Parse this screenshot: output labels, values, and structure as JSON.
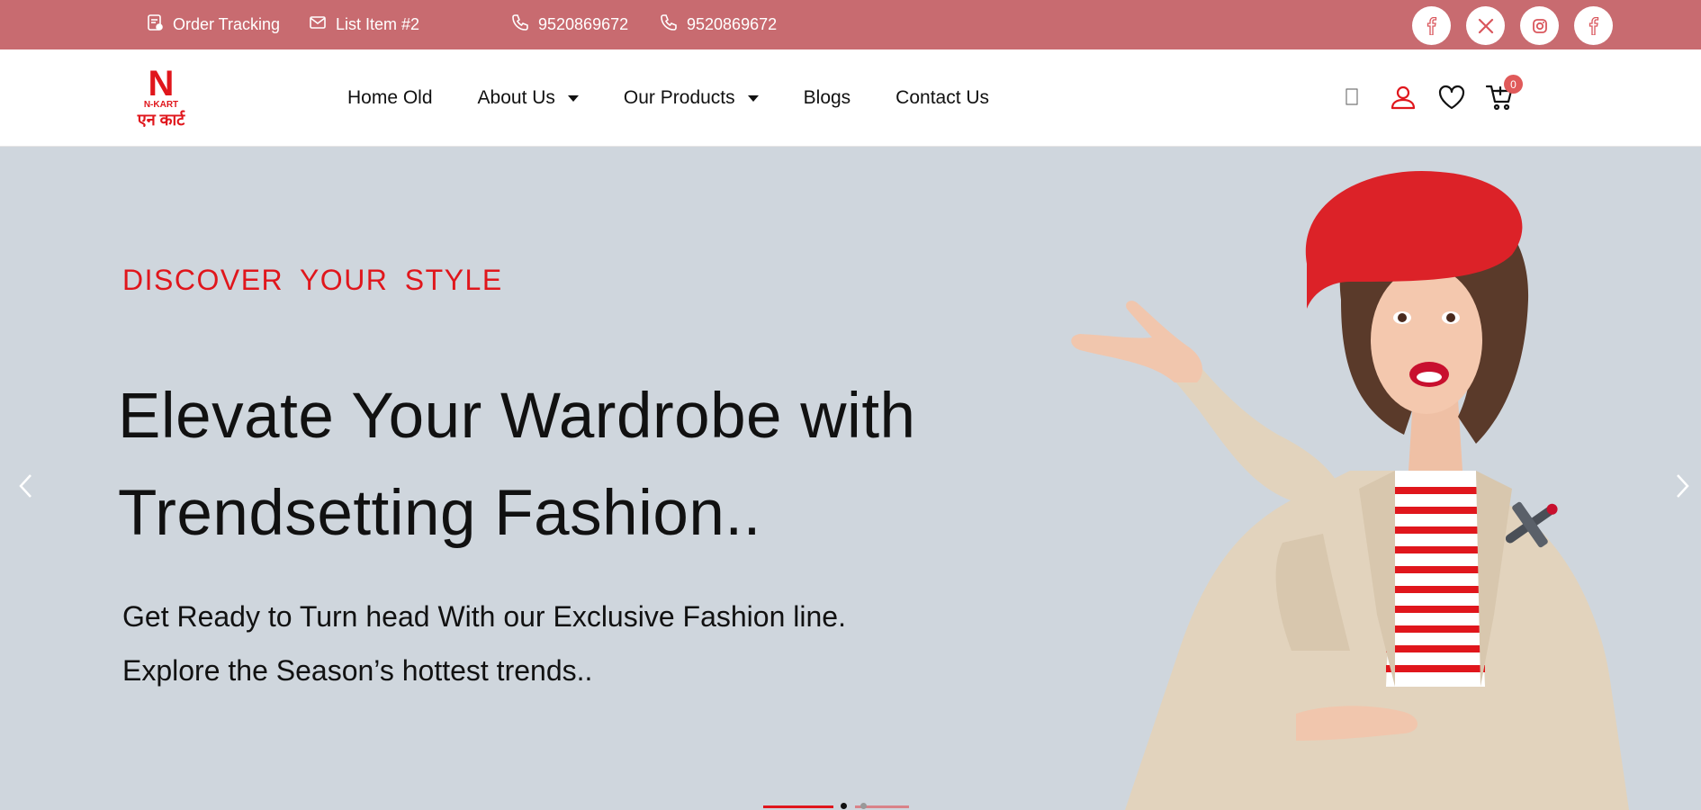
{
  "topbar": {
    "order_tracking": "Order Tracking",
    "list_item": "List Item #2",
    "phone_1": "9520869672",
    "phone_2": "9520869672",
    "background": "#c86b70",
    "socials": [
      "facebook-icon",
      "x-icon",
      "instagram-icon",
      "facebook-icon"
    ]
  },
  "header": {
    "logo": {
      "letter": "N",
      "brand": "N-KART",
      "hindi": "एन कार्ट"
    },
    "nav": [
      {
        "label": "Home Old",
        "has_dropdown": false
      },
      {
        "label": "About Us",
        "has_dropdown": true
      },
      {
        "label": "Our Products",
        "has_dropdown": true
      },
      {
        "label": "Blogs",
        "has_dropdown": false
      },
      {
        "label": "Contact Us",
        "has_dropdown": false
      }
    ],
    "icons": [
      "search-icon",
      "user-icon",
      "heart-icon",
      "cart-icon"
    ],
    "cart_count": "0"
  },
  "hero": {
    "eyebrow": "DISCOVER YOUR STYLE",
    "headline_line1": "Elevate Your Wardrobe with",
    "headline_line2": "Trendsetting Fashion..",
    "sub_line1": "Get Ready to Turn head With our Exclusive Fashion line.",
    "sub_line2": "Explore the Season’s hottest trends..",
    "background": "#cfd6dd",
    "accent": "#e0161c",
    "slides_total": 2,
    "slide_active": 1
  }
}
